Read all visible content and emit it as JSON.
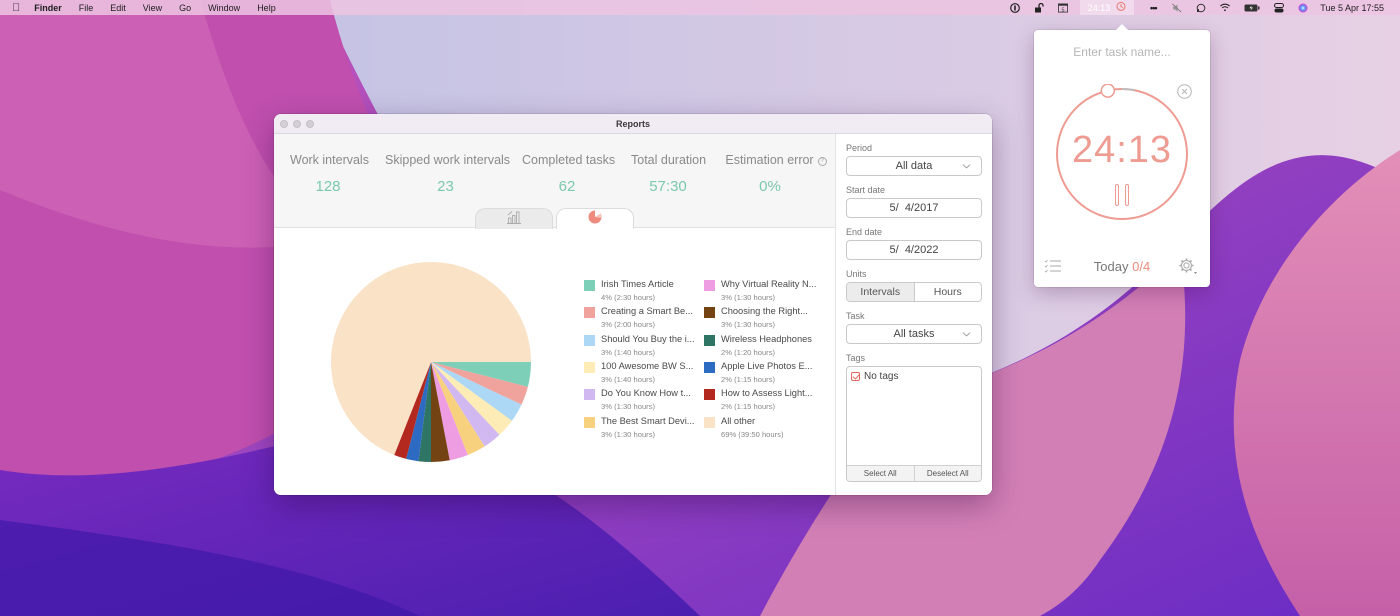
{
  "menubar": {
    "app_name": "Finder",
    "menus": [
      "File",
      "Edit",
      "View",
      "Go",
      "Window",
      "Help"
    ],
    "timer_display": "24:13",
    "date_time": "Tue 5 Apr  17:55",
    "status_icons": [
      "1password-icon",
      "lock-icon",
      "calendar-icon",
      "timer-clock-icon",
      "more-icon",
      "mute-icon",
      "headset-icon",
      "wifi-icon",
      "battery-icon",
      "control-center-icon",
      "siri-icon"
    ],
    "calendar_day": "5"
  },
  "window": {
    "title": "Reports",
    "stats": [
      {
        "label": "Work intervals",
        "value": "128"
      },
      {
        "label": "Skipped work intervals",
        "value": "23"
      },
      {
        "label": "Completed tasks",
        "value": "62"
      },
      {
        "label": "Total duration",
        "value": "57:30"
      },
      {
        "label": "Estimation error",
        "value": "0%"
      }
    ],
    "help_glyph": "?",
    "tabs": [
      {
        "icon": "bar-chart-icon",
        "active": false
      },
      {
        "icon": "pie-chart-icon",
        "active": true
      }
    ]
  },
  "chart_data": {
    "type": "pie",
    "title": "",
    "start_angle": "3 o'clock, clockwise",
    "legend_position": "right",
    "slices": [
      {
        "label": "Irish Times Article",
        "percent": 4,
        "hours": "2:30",
        "detail": "4% (2:30 hours)",
        "color": "#7ecfb8"
      },
      {
        "label": "Creating a Smart Be...",
        "percent": 3,
        "hours": "2:00",
        "detail": "3% (2:00 hours)",
        "color": "#f0a29d"
      },
      {
        "label": "Should You Buy the i...",
        "percent": 3,
        "hours": "1:40",
        "detail": "3% (1:40 hours)",
        "color": "#acd8f5"
      },
      {
        "label": "100 Awesome BW S...",
        "percent": 3,
        "hours": "1:40",
        "detail": "3% (1:40 hours)",
        "color": "#fdecb6"
      },
      {
        "label": "Do You Know How t...",
        "percent": 3,
        "hours": "1:30",
        "detail": "3% (1:30 hours)",
        "color": "#d1b8f0"
      },
      {
        "label": "The Best Smart Devi...",
        "percent": 3,
        "hours": "1:30",
        "detail": "3% (1:30 hours)",
        "color": "#f8d17e"
      },
      {
        "label": "Why Virtual Reality N...",
        "percent": 3,
        "hours": "1:30",
        "detail": "3% (1:30 hours)",
        "color": "#ef9de3"
      },
      {
        "label": "Choosing the Right...",
        "percent": 3,
        "hours": "1:30",
        "detail": "3% (1:30 hours)",
        "color": "#744314"
      },
      {
        "label": "Wireless Headphones",
        "percent": 2,
        "hours": "1:20",
        "detail": "2% (1:20 hours)",
        "color": "#2f7565"
      },
      {
        "label": "Apple Live Photos E...",
        "percent": 2,
        "hours": "1:15",
        "detail": "2% (1:15 hours)",
        "color": "#2d6bc3"
      },
      {
        "label": "How to Assess Light...",
        "percent": 2,
        "hours": "1:15",
        "detail": "2% (1:15 hours)",
        "color": "#b3281f"
      },
      {
        "label": "All other",
        "percent": 69,
        "hours": "39:50",
        "detail": "69% (39:50 hours)",
        "color": "#f9e2c6"
      }
    ]
  },
  "sidebar": {
    "period_label": "Period",
    "period_value": "All data",
    "start_label": "Start date",
    "start_value": "5/  4/2017",
    "end_label": "End date",
    "end_value": "5/  4/2022",
    "units_label": "Units",
    "units_options": [
      "Intervals",
      "Hours"
    ],
    "units_selected": "Intervals",
    "task_label": "Task",
    "task_value": "All tasks",
    "tags_label": "Tags",
    "tags": [
      {
        "label": "No tags",
        "checked": true
      }
    ],
    "select_all": "Select All",
    "deselect_all": "Deselect All"
  },
  "popover": {
    "task_placeholder": "Enter task name...",
    "timer": "24:13",
    "progress_fraction_elapsed": 0.03,
    "today_label": "Today",
    "today_count": "0/4"
  },
  "colors": {
    "accent_timer": "#ee9c92",
    "stat_value": "#7cc8ad"
  }
}
